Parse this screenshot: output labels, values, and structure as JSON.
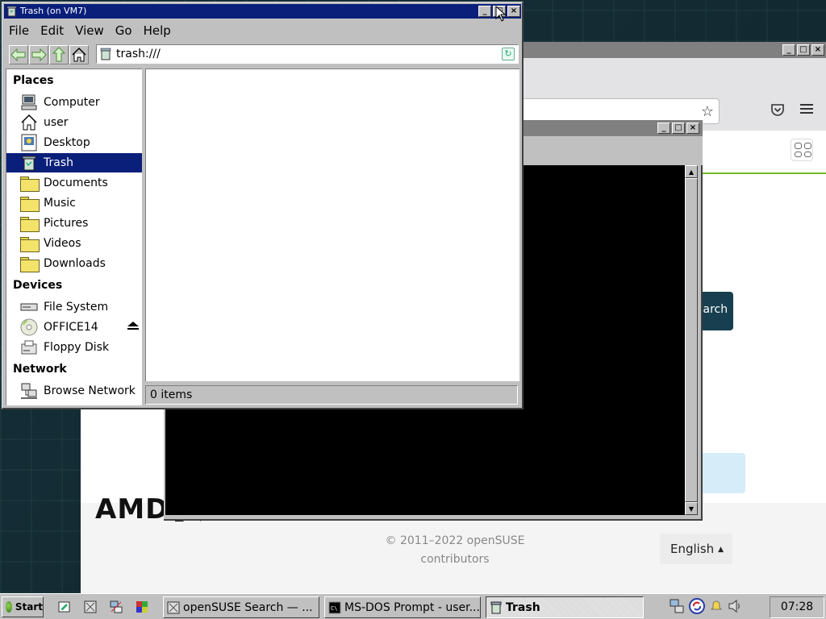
{
  "file_manager": {
    "title": "Trash (on VM7)",
    "menu": [
      "File",
      "Edit",
      "View",
      "Go",
      "Help"
    ],
    "location": "trash:///",
    "sidebar": {
      "places_heading": "Places",
      "places": [
        {
          "label": "Computer",
          "icon": "computer-icon"
        },
        {
          "label": "user",
          "icon": "home-icon"
        },
        {
          "label": "Desktop",
          "icon": "desktop-icon"
        },
        {
          "label": "Trash",
          "icon": "trash-icon",
          "selected": true
        },
        {
          "label": "Documents",
          "icon": "folder-icon"
        },
        {
          "label": "Music",
          "icon": "folder-icon"
        },
        {
          "label": "Pictures",
          "icon": "folder-icon"
        },
        {
          "label": "Videos",
          "icon": "folder-icon"
        },
        {
          "label": "Downloads",
          "icon": "folder-icon"
        }
      ],
      "devices_heading": "Devices",
      "devices": [
        {
          "label": "File System",
          "icon": "drive-icon"
        },
        {
          "label": "OFFICE14",
          "icon": "cdrom-icon"
        },
        {
          "label": "Floppy Disk",
          "icon": "floppy-icon"
        }
      ],
      "network_heading": "Network",
      "network": [
        {
          "label": "Browse Network",
          "icon": "network-icon"
        }
      ]
    },
    "status": "0 items",
    "window_buttons": {
      "minimize": "_",
      "maximize": "□",
      "close": "×"
    }
  },
  "browser": {
    "search_button": "Search",
    "footer": {
      "logo_text": "AMD",
      "copyright_line1": "© 2011–2022 openSUSE",
      "copyright_line2": "contributors",
      "language": "English"
    }
  },
  "taskbar": {
    "start_label": "Start",
    "tasks": [
      {
        "label": "openSUSE Search — ...",
        "active": false
      },
      {
        "label": "MS-DOS Prompt - user...",
        "active": false
      },
      {
        "label": "Trash",
        "active": true
      }
    ],
    "clock": "07:28 AM"
  },
  "colors": {
    "title_active": "#0a1f7a",
    "selection": "#0a1f7a",
    "face": "#c0c0c0",
    "opensuse_dark": "#173f4f",
    "opensuse_green": "#73ba25"
  }
}
